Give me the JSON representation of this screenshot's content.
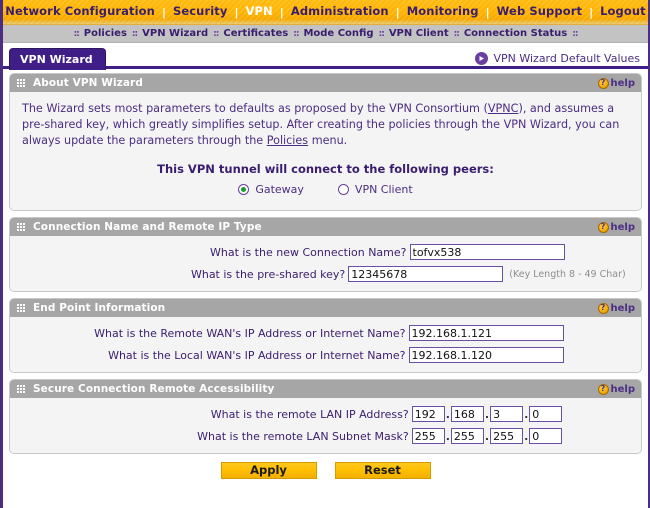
{
  "topnav": {
    "separator": "|",
    "items": [
      {
        "label": "Network Configuration",
        "active": false
      },
      {
        "label": "Security",
        "active": false
      },
      {
        "label": "VPN",
        "active": true
      },
      {
        "label": "Administration",
        "active": false
      },
      {
        "label": "Monitoring",
        "active": false
      },
      {
        "label": "Web Support",
        "active": false
      },
      {
        "label": "Logout",
        "active": false
      }
    ]
  },
  "subnav": {
    "separator": "::",
    "items": [
      {
        "label": "Policies"
      },
      {
        "label": "VPN Wizard"
      },
      {
        "label": "Certificates"
      },
      {
        "label": "Mode Config"
      },
      {
        "label": "VPN Client"
      },
      {
        "label": "Connection Status"
      }
    ]
  },
  "tabbar": {
    "active_tab": "VPN Wizard",
    "default_values_link": "VPN Wizard Default Values",
    "default_values_icon": "arrow-right-circle-icon"
  },
  "help": {
    "label": "help",
    "icon": "question-mark-icon"
  },
  "sections": {
    "about": {
      "title": "About VPN Wizard",
      "paragraph_part1": "The Wizard sets most parameters to defaults as proposed by the VPN Consortium (",
      "link_vpnc": "VPNC",
      "paragraph_part2": "), and assumes a pre-shared key, which greatly simplifies setup. After creating the policies through the VPN Wizard, you can always update the parameters through the ",
      "link_policies": "Policies",
      "paragraph_part3": " menu.",
      "peers_title": "This VPN tunnel will connect to the following peers:",
      "options": [
        {
          "label": "Gateway",
          "selected": true
        },
        {
          "label": "VPN Client",
          "selected": false
        }
      ]
    },
    "connection": {
      "title": "Connection Name and Remote IP Type",
      "fields": [
        {
          "label": "What is the new Connection Name?",
          "value": "tofvx538",
          "hint": ""
        },
        {
          "label": "What is the pre-shared key?",
          "value": "12345678",
          "hint": "(Key Length 8 - 49 Char)"
        }
      ]
    },
    "endpoint": {
      "title": "End Point Information",
      "fields": [
        {
          "label": "What is the Remote WAN's IP Address or Internet Name?",
          "value": "192.168.1.121"
        },
        {
          "label": "What is the Local WAN's IP Address or Internet Name?",
          "value": "192.168.1.120"
        }
      ]
    },
    "secure": {
      "title": "Secure Connection Remote Accessibility",
      "rows": [
        {
          "label": "What is the remote LAN IP Address?",
          "octets": [
            "192",
            "168",
            "3",
            "0"
          ]
        },
        {
          "label": "What is the remote LAN Subnet Mask?",
          "octets": [
            "255",
            "255",
            "255",
            "0"
          ]
        }
      ],
      "octet_separator": "."
    }
  },
  "buttons": {
    "apply": "Apply",
    "reset": "Reset"
  },
  "colors": {
    "nav_orange": "#ffb300",
    "subnav_gray": "#c3c3c3",
    "purple": "#4b2e83",
    "tab_purple": "#3f1f87",
    "panel_header_gray": "#a6a6a6",
    "button_gold": "#ffbe00",
    "radio_selected_green": "#1a9c2e"
  }
}
